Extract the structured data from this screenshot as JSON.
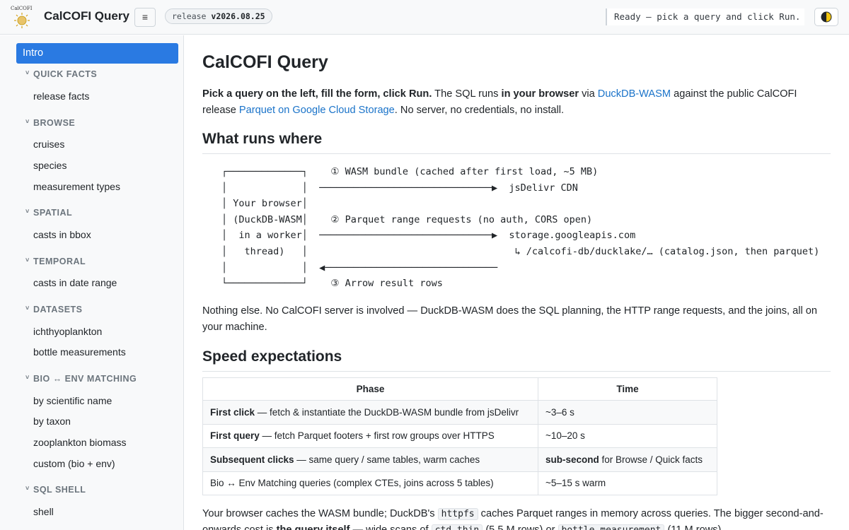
{
  "header": {
    "logo_text": "CalCOFI",
    "title": "CalCOFI Query",
    "menu_glyph": "≡",
    "release_label": "release",
    "release_version": "v2026.08.25",
    "status": "Ready — pick a query and click Run.",
    "theme_icon": "half-moon-icon"
  },
  "sidebar": {
    "active": "Intro",
    "sections": [
      {
        "label": "QUICK FACTS",
        "items": [
          "release facts"
        ]
      },
      {
        "label": "BROWSE",
        "items": [
          "cruises",
          "species",
          "measurement types"
        ]
      },
      {
        "label": "SPATIAL",
        "items": [
          "casts in bbox"
        ]
      },
      {
        "label": "TEMPORAL",
        "items": [
          "casts in date range"
        ]
      },
      {
        "label": "DATASETS",
        "items": [
          "ichthyoplankton",
          "bottle measurements"
        ]
      },
      {
        "label": "BIO ↔ ENV MATCHING",
        "items": [
          "by scientific name",
          "by taxon",
          "zooplankton biomass",
          "custom (bio + env)"
        ]
      },
      {
        "label": "SQL SHELL",
        "items": [
          "shell"
        ]
      }
    ]
  },
  "main": {
    "title": "CalCOFI Query",
    "intro": {
      "lead": "Pick a query on the left, fill the form, click Run.",
      "t1": " The SQL runs ",
      "bold1": "in your browser",
      "t2": " via ",
      "link1": "DuckDB-WASM",
      "t3": " against the public CalCOFI release ",
      "link2": "Parquet on Google Cloud Storage",
      "t4": ". No server, no credentials, no install."
    },
    "h2_where": "What runs where",
    "diagram": [
      "┌─────────────┐    ① WASM bundle (cached after first load, ~5 MB)",
      "│             │  ──────────────────────────────▶  jsDelivr CDN",
      "│ Your browser│",
      "│ (DuckDB-WASM│    ② Parquet range requests (no auth, CORS open)",
      "│  in a worker│  ──────────────────────────────▶  storage.googleapis.com",
      "│   thread)   │                                    ↳ /calcofi-db/ducklake/… (catalog.json, then parquet)",
      "│             │  ◀──────────────────────────────",
      "└─────────────┘    ③ Arrow result rows"
    ],
    "after_diagram": "Nothing else. No CalCOFI server is involved — DuckDB-WASM does the SQL planning, the HTTP range requests, and the joins, all on your machine.",
    "h2_speed": "Speed expectations",
    "table": {
      "headers": [
        "Phase",
        "Time"
      ],
      "rows": [
        {
          "bold": "First click",
          "rest": " — fetch & instantiate the DuckDB-WASM bundle from jsDelivr",
          "time_bold": "",
          "time": "~3–6 s"
        },
        {
          "bold": "First query",
          "rest": " — fetch Parquet footers + first row groups over HTTPS",
          "time_bold": "",
          "time": "~10–20 s"
        },
        {
          "bold": "Subsequent clicks",
          "rest": " — same query / same tables, warm caches",
          "time_bold": "sub-second",
          "time": " for Browse / Quick facts"
        },
        {
          "bold": "",
          "rest": "Bio ↔ Env Matching queries (complex CTEs, joins across 5 tables)",
          "time_bold": "",
          "time": "~5–15 s warm"
        }
      ]
    },
    "footer_para": {
      "t1": "Your browser caches the WASM bundle; DuckDB's ",
      "code1": "httpfs",
      "t2": " caches Parquet ranges in memory across queries. The bigger second-and-onwards cost is ",
      "bold1": "the query itself",
      "t3": " — wide scans of ",
      "code2": "ctd_thin",
      "t4": " (5.5 M rows) or ",
      "code3": "bottle_measurement",
      "t5": " (11 M rows)."
    }
  }
}
